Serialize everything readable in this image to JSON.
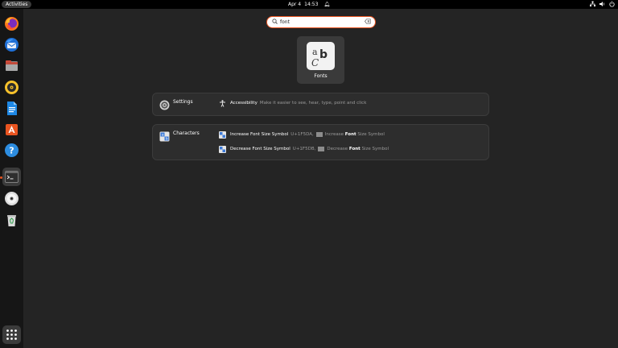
{
  "topbar": {
    "activities": "Activities",
    "date": "Apr 4",
    "time": "14:53"
  },
  "dock": {
    "apps": [
      {
        "name": "Firefox",
        "icon": "firefox-icon"
      },
      {
        "name": "Thunderbird",
        "icon": "thunderbird-icon"
      },
      {
        "name": "Files",
        "icon": "files-icon"
      },
      {
        "name": "Rhythmbox",
        "icon": "rhythmbox-icon"
      },
      {
        "name": "LibreOffice Writer",
        "icon": "writer-icon"
      },
      {
        "name": "Ubuntu Software",
        "icon": "software-center-icon"
      },
      {
        "name": "Help",
        "icon": "help-icon"
      },
      {
        "name": "Terminal",
        "icon": "terminal-icon"
      },
      {
        "name": "Disc",
        "icon": "disc-icon"
      },
      {
        "name": "Trash",
        "icon": "trash-icon"
      }
    ],
    "show_apps": "app-grid-icon"
  },
  "search": {
    "value": "font",
    "placeholder": ""
  },
  "app_results": [
    {
      "label": "Fonts",
      "icon": "fonts-icon"
    }
  ],
  "providers": {
    "settings": {
      "name": "Settings",
      "results": [
        {
          "title": "Accessibility",
          "description": "Make it easier to see, hear, type, point and click"
        }
      ]
    },
    "characters": {
      "name": "Characters",
      "results": [
        {
          "title": "Increase Font Size Symbol",
          "code": "U+1F5DA,",
          "desc_pre": "Increase",
          "desc_bold": "Font",
          "desc_post": "Size Symbol"
        },
        {
          "title": "Decrease Font Size Symbol",
          "code": "U+1F5DB,",
          "desc_pre": "Decrease",
          "desc_bold": "Font",
          "desc_post": "Size Symbol"
        }
      ]
    }
  },
  "colors": {
    "accent": "#e95420",
    "panel": "#2d2d2d",
    "background": "#242424"
  }
}
